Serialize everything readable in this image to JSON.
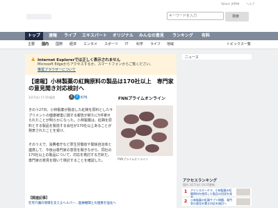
{
  "topbar": {
    "links": [
      "Yahoo! JAPAN",
      "ヘルプ"
    ]
  },
  "header": {
    "search_placeholder": "キーワードを入力",
    "search_button": "検索"
  },
  "main_nav": [
    "トップ",
    "速報",
    "ライブ",
    "エキスパート",
    "オリジナル",
    "みんなの意見",
    "ランキング",
    "有料"
  ],
  "sub_nav": [
    "主要",
    "国内",
    "国際",
    "経済",
    "エンタメ",
    "スポーツ",
    "IT",
    "科学",
    "ライフ",
    "地域",
    "トピックス一覧"
  ],
  "notice": {
    "title": "Internet Explorerでは正しく表示されません",
    "line1": "Microsoft Edgeからアクセスするか、スマートフォンからご覧ください。",
    "link": "推奨ブラウザーについて"
  },
  "article": {
    "headline": "【速報】小林製薬の紅麹原料の製品は170社以上　専門家の意見聞き対応検討へ",
    "meta": "3/27(水) 17:19 配信",
    "share_count": "676",
    "source": "FNNプライムオンライン",
    "para1": "きのう27日、小林製薬が製造した紅麹を原料としたサプリメントの健康被害に関する報告が新たに5件寄せられたことが明らかになった。小林製薬は、紅麹を原料とする製品を製造する会社が170社以上あることが発表されたことを受け、",
    "para2": "そのうえで、消費者庁など厚生労働省や関係自治体と連携して、今後は専門家の意見を聞きながら、同社の170社以上の製品について、対応を検討する方針だ。専門家の意見を聞いて検討することを確認した。",
    "photo_caption": "FNNプライムオンライン",
    "related_label": "【関連記事】",
    "related_link": "在宅介護の現場を支えるヘルパー…医療機関との連携を強化へ"
  },
  "sidebar": {
    "top_label": "ニュース",
    "ranking_title": "アクセスランキング",
    "ranking_sub": "国内 3/27(水) 19:35更新",
    "ranking": [
      {
        "num": "1",
        "text": "アイリスオーヤマ、小林製薬の紅麹原料を使用した製品の回収を発表"
      },
      {
        "num": "2",
        "text": "小林製薬の紅麹サプリ問題、専門家の意見を聞き対応を検討へ"
      }
    ]
  }
}
